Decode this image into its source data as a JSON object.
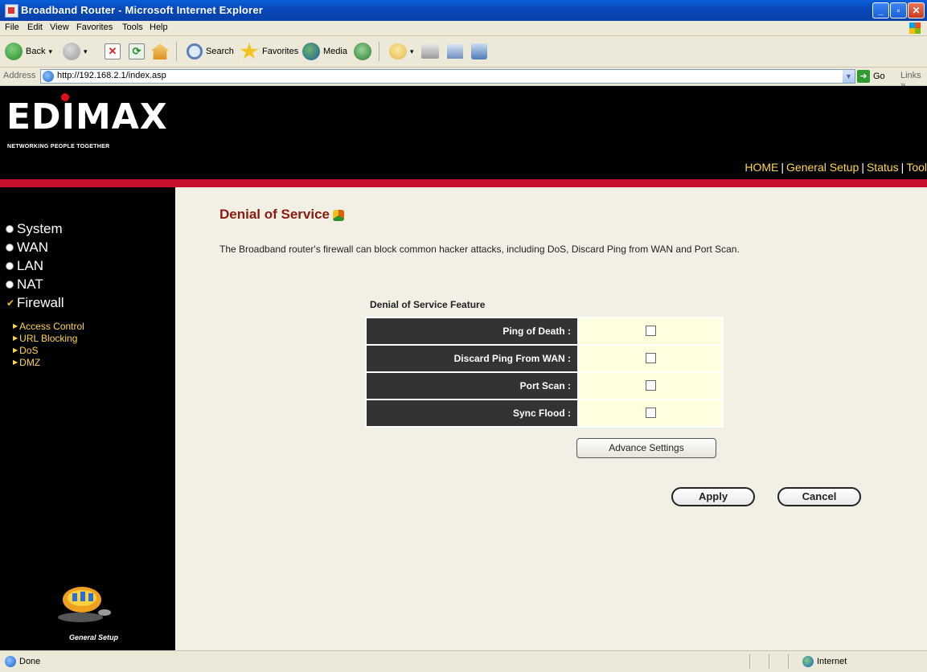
{
  "window": {
    "title": "Broadband Router - Microsoft Internet Explorer"
  },
  "menu": [
    "File",
    "Edit",
    "View",
    "Favorites",
    "Tools",
    "Help"
  ],
  "toolbar": {
    "back": "Back",
    "search": "Search",
    "favorites": "Favorites",
    "media": "Media"
  },
  "address": {
    "label": "Address",
    "url": "http://192.168.2.1/index.asp",
    "go": "Go",
    "links": "Links »"
  },
  "header": {
    "brand": "EDIMAX",
    "tagline": "NETWORKING PEOPLE TOGETHER",
    "nav": [
      "HOME",
      "General Setup",
      "Status",
      "Tool"
    ]
  },
  "sidebar": {
    "items": [
      {
        "label": "System"
      },
      {
        "label": "WAN"
      },
      {
        "label": "LAN"
      },
      {
        "label": "NAT"
      },
      {
        "label": "Firewall"
      }
    ],
    "subitems": [
      "Access Control",
      "URL Blocking",
      "DoS",
      "DMZ"
    ],
    "footer": "General Setup"
  },
  "main": {
    "title": "Denial of Service",
    "description": "The Broadband router's firewall can block common hacker attacks, including DoS, Discard Ping from WAN and Port Scan.",
    "feature_label": "Denial of Service Feature",
    "features": [
      {
        "label": "Ping of Death :",
        "checked": false
      },
      {
        "label": "Discard Ping From WAN :",
        "checked": false
      },
      {
        "label": "Port Scan :",
        "checked": false
      },
      {
        "label": "Sync Flood :",
        "checked": false
      }
    ],
    "advance_button": "Advance Settings",
    "apply_button": "Apply",
    "cancel_button": "Cancel"
  },
  "status": {
    "left": "Done",
    "zone": "Internet"
  },
  "colors": {
    "accent_red": "#c8102e",
    "title_red": "#8b1a10",
    "nav_yellow": "#ffd84a",
    "label_bg": "#333333",
    "value_bg": "#ffffe0"
  }
}
